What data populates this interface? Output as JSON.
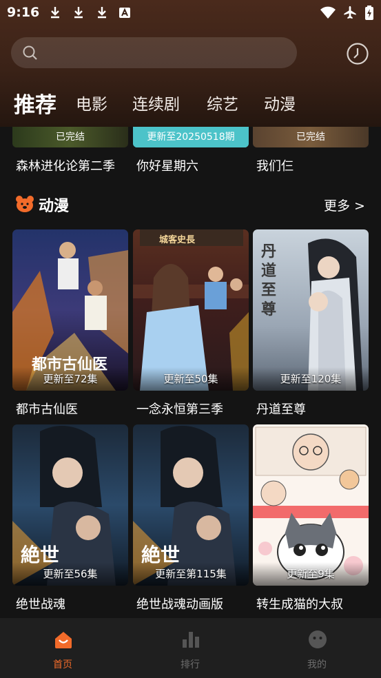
{
  "status_bar": {
    "time": "9:16"
  },
  "search": {
    "placeholder": ""
  },
  "tabs": [
    {
      "label": "推荐",
      "active": true
    },
    {
      "label": "电影"
    },
    {
      "label": "连续剧"
    },
    {
      "label": "综艺"
    },
    {
      "label": "动漫"
    }
  ],
  "previous_row": [
    {
      "title": "森林进化论第二季",
      "badge": "已完结"
    },
    {
      "title": "你好星期六",
      "badge": "更新至20250518期"
    },
    {
      "title": "我们仨",
      "badge": "已完结"
    }
  ],
  "section": {
    "title": "动漫",
    "more_label": "更多 >",
    "items": [
      {
        "title": "都市古仙医",
        "badge": "更新至72集",
        "art_text": "都市古仙医"
      },
      {
        "title": "一念永恒第三季",
        "badge": "更新至50集",
        "art_text": "城客史長"
      },
      {
        "title": "丹道至尊",
        "badge": "更新至120集",
        "art_text": "丹道至尊"
      },
      {
        "title": "绝世战魂",
        "badge": "更新至56集",
        "art_text": "絶世"
      },
      {
        "title": "绝世战魂动画版",
        "badge": "更新至第115集",
        "art_text": "絶世"
      },
      {
        "title": "转生成猫的大叔",
        "badge": "更新至9集"
      }
    ]
  },
  "bottom_nav": [
    {
      "label": "首页",
      "active": true
    },
    {
      "label": "排行"
    },
    {
      "label": "我的"
    }
  ],
  "colors": {
    "accent": "#f26b2a",
    "header_top": "#4a2a1c",
    "background": "#141414",
    "nav_background": "#1f1f1f",
    "teal_badge": "#4cc3c9"
  }
}
